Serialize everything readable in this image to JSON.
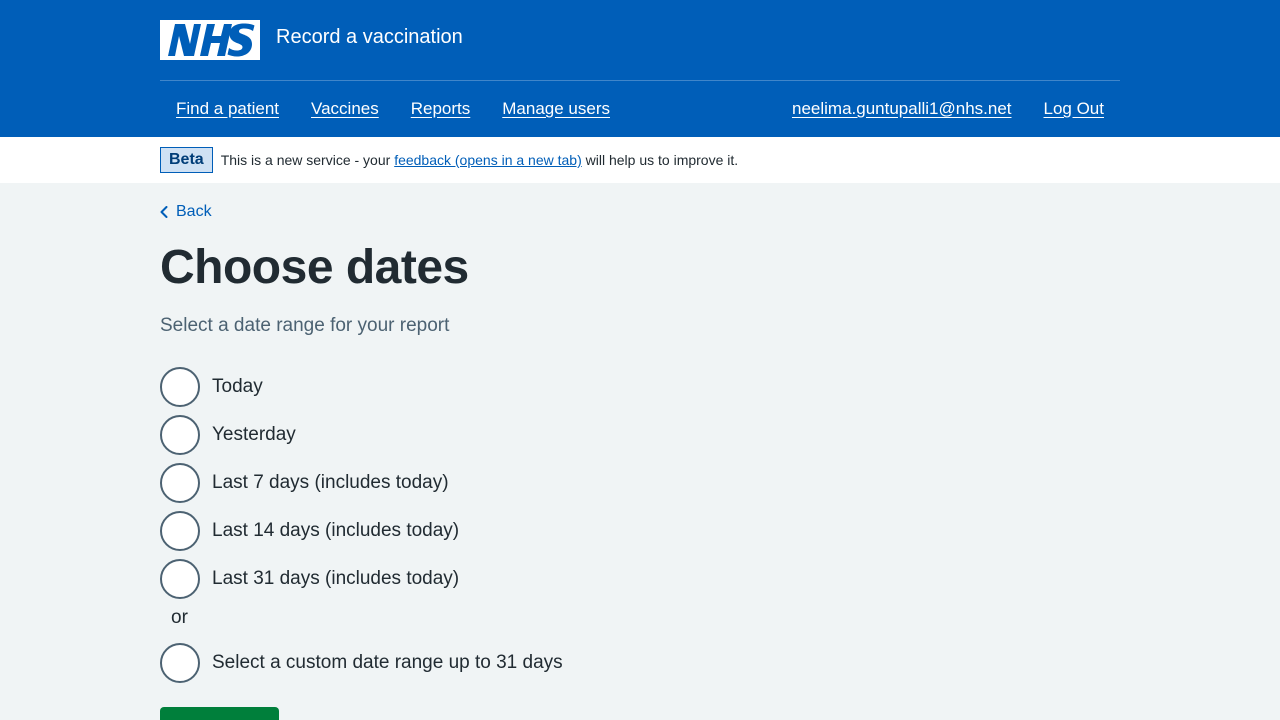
{
  "header": {
    "logo_text": "NHS",
    "service_name": "Record a vaccination",
    "colors": {
      "brand": "#005eb8",
      "white": "#ffffff"
    }
  },
  "nav": {
    "items": [
      {
        "label": "Find a patient"
      },
      {
        "label": "Vaccines"
      },
      {
        "label": "Reports"
      },
      {
        "label": "Manage users"
      }
    ],
    "user_email": "neelima.guntupalli1@nhs.net",
    "logout_label": "Log Out"
  },
  "beta": {
    "tag": "Beta",
    "text_before": "This is a new service - your ",
    "link_text": "feedback (opens in a new tab)",
    "text_after": " will help us to improve it."
  },
  "main": {
    "back_label": "Back",
    "title": "Choose dates",
    "hint": "Select a date range for your report",
    "options": [
      {
        "label": "Today",
        "selected": false
      },
      {
        "label": "Yesterday",
        "selected": false
      },
      {
        "label": "Last 7 days (includes today)",
        "selected": false
      },
      {
        "label": "Last 14 days (includes today)",
        "selected": false
      },
      {
        "label": "Last 31 days (includes today)",
        "selected": false
      }
    ],
    "or_divider": "or",
    "custom_option": {
      "label": "Select a custom date range up to 31 days",
      "selected": false
    },
    "continue_color": "#007f3b"
  }
}
